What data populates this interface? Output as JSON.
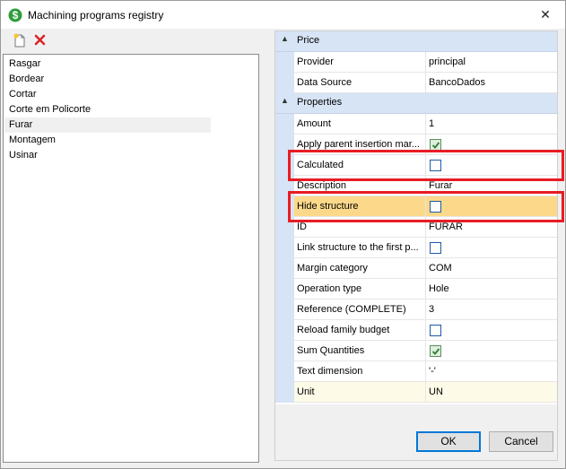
{
  "window": {
    "title": "Machining programs registry",
    "icon": "dollar-app-icon"
  },
  "toolbar": {
    "new_icon": "new-document-icon",
    "delete_icon": "delete-x-icon"
  },
  "list": {
    "items": [
      "Rasgar",
      "Bordear",
      "Cortar",
      "Corte em Policorte",
      "Furar",
      "Montagem",
      "Usinar"
    ],
    "selected": "Furar"
  },
  "properties": {
    "categories": [
      {
        "label": "Price",
        "rows": [
          {
            "name": "Provider",
            "value": "principal"
          },
          {
            "name": "Data Source",
            "value": "BancoDados"
          }
        ]
      },
      {
        "label": "Properties",
        "rows": [
          {
            "name": "Amount",
            "value": "1"
          },
          {
            "name": "Apply parent insertion mar...",
            "checkbox": true,
            "checked": true
          },
          {
            "name": "Calculated",
            "checkbox": true,
            "checked": false
          },
          {
            "name": "Description",
            "value": "Furar"
          },
          {
            "name": "Hide structure",
            "checkbox": true,
            "checked": false
          },
          {
            "name": "ID",
            "value": "FURAR"
          },
          {
            "name": "Link structure to the first p...",
            "checkbox": true,
            "checked": false
          },
          {
            "name": "Margin category",
            "value": "COM"
          },
          {
            "name": "Operation type",
            "value": "Hole"
          },
          {
            "name": "Reference (COMPLETE)",
            "value": "3"
          },
          {
            "name": "Reload family budget",
            "checkbox": true,
            "checked": false
          },
          {
            "name": "Sum Quantities",
            "checkbox": true,
            "checked": true
          },
          {
            "name": "Text dimension",
            "value": "'-'"
          },
          {
            "name": "Unit",
            "value": "UN"
          }
        ]
      }
    ],
    "selected_row": "Hide structure",
    "highlighted_rows": [
      "Calculated",
      "Hide structure"
    ]
  },
  "buttons": {
    "ok": "OK",
    "cancel": "Cancel"
  },
  "colors": {
    "category_bg": "#d6e4f5",
    "selected_row": "#fcd98a",
    "highlight_border": "#e81c24",
    "ok_border": "#0078d7"
  }
}
